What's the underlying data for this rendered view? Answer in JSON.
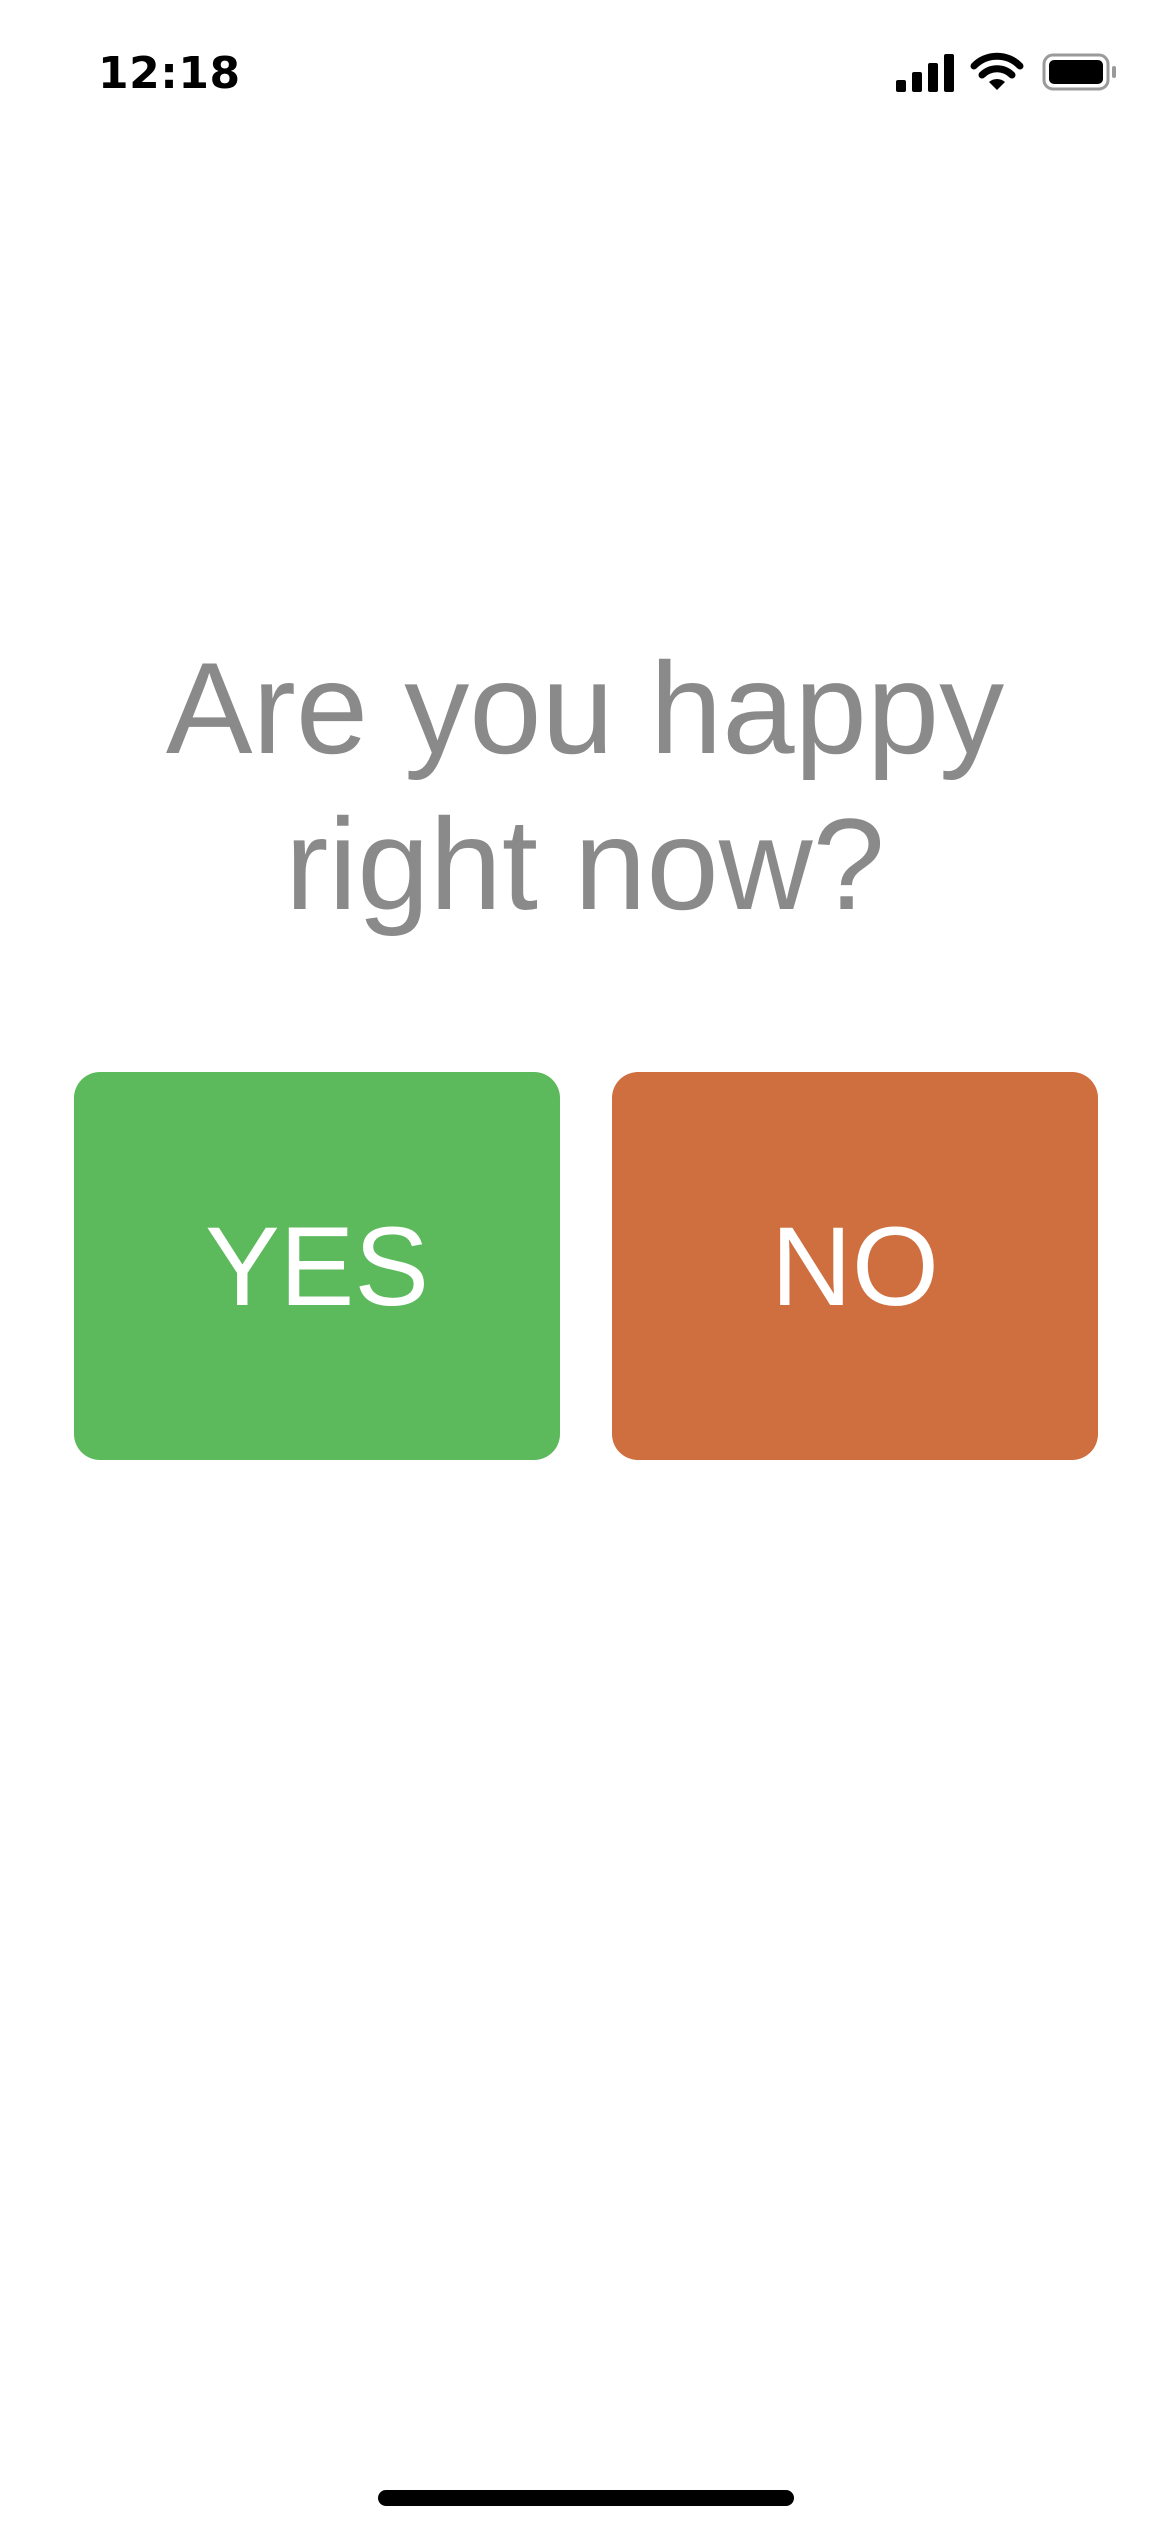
{
  "status_bar": {
    "time": "12:18",
    "icons": [
      "cellular-signal-icon",
      "wifi-icon",
      "battery-icon"
    ]
  },
  "question": {
    "line1": "Are you happy",
    "line2": "right now?"
  },
  "answers": {
    "yes_label": "YES",
    "no_label": "NO"
  },
  "colors": {
    "yes": "#5cba5c",
    "no": "#cf6e3e",
    "question_text": "#8a8a8a"
  }
}
